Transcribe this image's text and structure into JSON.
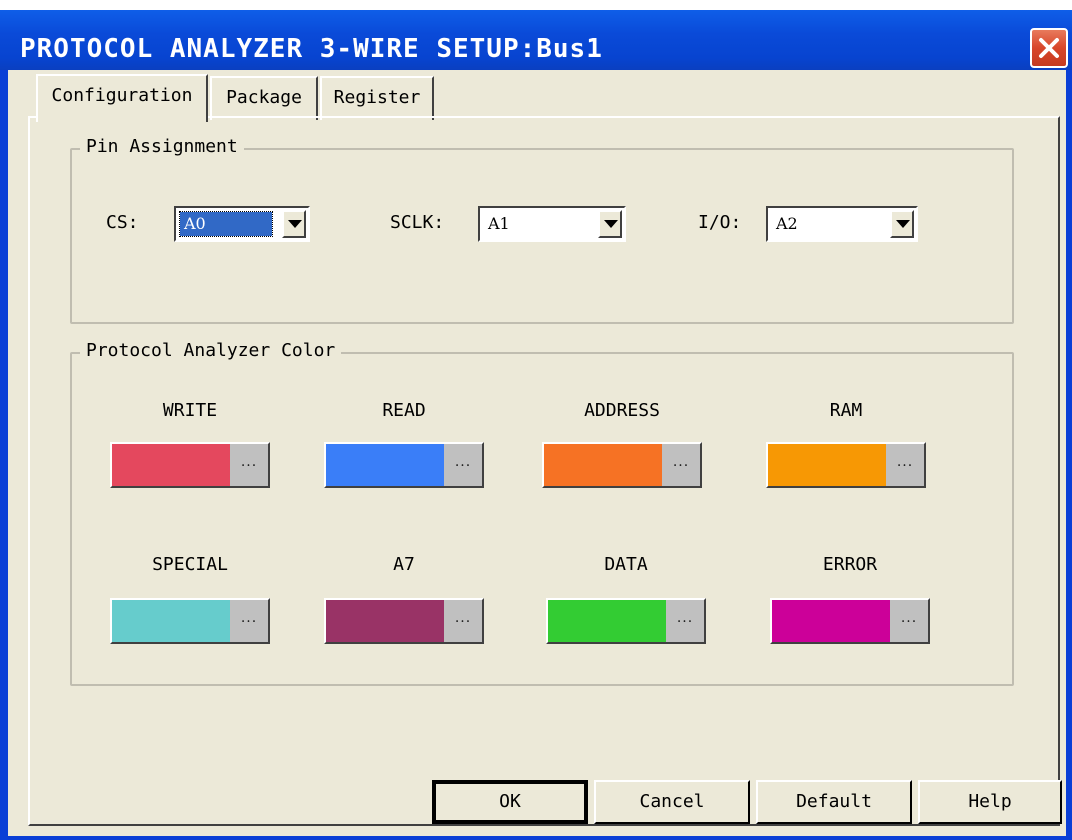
{
  "window": {
    "title": "PROTOCOL ANALYZER 3-WIRE SETUP:Bus1",
    "close_icon": "close-icon"
  },
  "tabs": [
    {
      "label": "Configuration",
      "active": true
    },
    {
      "label": "Package",
      "active": false
    },
    {
      "label": "Register",
      "active": false
    }
  ],
  "pin_assignment": {
    "title": "Pin Assignment",
    "cs": {
      "label": "CS:",
      "value": "A0",
      "selected": true
    },
    "sclk": {
      "label": "SCLK:",
      "value": "A1"
    },
    "io": {
      "label": "I/O:",
      "value": "A2"
    }
  },
  "colors": {
    "title": "Protocol Analyzer Color",
    "items": [
      {
        "label": "WRITE",
        "color": "#e4485e"
      },
      {
        "label": "READ",
        "color": "#3a7ef8"
      },
      {
        "label": "ADDRESS",
        "color": "#f67224"
      },
      {
        "label": "RAM",
        "color": "#f79804"
      },
      {
        "label": "SPECIAL",
        "color": "#66cccc"
      },
      {
        "label": "A7",
        "color": "#993366"
      },
      {
        "label": "DATA",
        "color": "#33cc33"
      },
      {
        "label": "ERROR",
        "color": "#cc0099"
      }
    ],
    "button_dots": "..."
  },
  "buttons": {
    "ok": "OK",
    "cancel": "Cancel",
    "default": "Default",
    "help": "Help"
  }
}
